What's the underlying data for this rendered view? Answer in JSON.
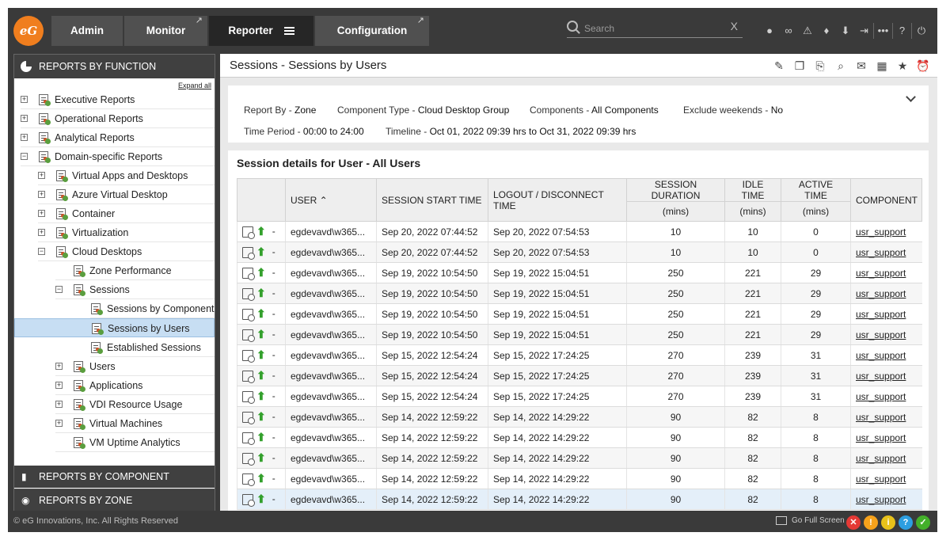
{
  "app": {
    "logo_text": "eG",
    "nav": [
      {
        "label": "Admin"
      },
      {
        "label": "Monitor"
      },
      {
        "label": "Reporter"
      },
      {
        "label": "Configuration"
      }
    ],
    "search_placeholder": "Search"
  },
  "left_panel": {
    "header": "REPORTS BY FUNCTION",
    "expand_all": "Expand all",
    "tree": [
      {
        "label": "Executive Reports",
        "toggle": "+"
      },
      {
        "label": "Operational Reports",
        "toggle": "+"
      },
      {
        "label": "Analytical Reports",
        "toggle": "+"
      },
      {
        "label": "Domain-specific Reports",
        "toggle": "−"
      },
      {
        "label": "Virtual Apps and Desktops",
        "toggle": "+"
      },
      {
        "label": "Azure Virtual Desktop",
        "toggle": "+"
      },
      {
        "label": "Container",
        "toggle": "+"
      },
      {
        "label": "Virtualization",
        "toggle": "+"
      },
      {
        "label": "Cloud Desktops",
        "toggle": "−"
      },
      {
        "label": "Zone Performance",
        "toggle": ""
      },
      {
        "label": "Sessions",
        "toggle": "−"
      },
      {
        "label": "Sessions by Component",
        "toggle": ""
      },
      {
        "label": "Sessions by Users",
        "toggle": ""
      },
      {
        "label": "Established Sessions",
        "toggle": ""
      },
      {
        "label": "Users",
        "toggle": "+"
      },
      {
        "label": "Applications",
        "toggle": "+"
      },
      {
        "label": "VDI Resource Usage",
        "toggle": "+"
      },
      {
        "label": "Virtual Machines",
        "toggle": "+"
      },
      {
        "label": "VM Uptime Analytics",
        "toggle": ""
      }
    ],
    "footer_by_component": "REPORTS BY COMPONENT",
    "footer_by_zone": "REPORTS BY ZONE"
  },
  "main": {
    "title": "Sessions - Sessions by Users",
    "filters": {
      "report_by_label": "Report By - ",
      "report_by_value": "Zone",
      "component_type_label": "Component Type - ",
      "component_type_value": "Cloud Desktop Group",
      "components_label": "Components - ",
      "components_value": "All Components",
      "exclude_weekends_label": "Exclude weekends - ",
      "exclude_weekends_value": "No",
      "time_period_label": "Time Period - ",
      "time_period_value": "00:00 to 24:00",
      "timeline_label": "Timeline - ",
      "timeline_value": "Oct 01, 2022 09:39 hrs to Oct 31, 2022 09:39 hrs"
    },
    "table_title": "Session details for User - All Users",
    "columns": {
      "user": "USER",
      "start": "SESSION START TIME",
      "logout": "LOGOUT / DISCONNECT TIME",
      "duration": "SESSION DURATION",
      "idle": "IDLE TIME",
      "active": "ACTIVE TIME",
      "component": "COMPONENT",
      "unit": "(mins)"
    },
    "rows": [
      {
        "dash": "-",
        "user": "egdevavd\\w365...",
        "start": "Sep 20, 2022 07:44:52",
        "logout": "Sep 20, 2022 07:54:53",
        "duration": "10",
        "idle": "10",
        "active": "0",
        "component": "usr_support"
      },
      {
        "dash": "-",
        "user": "egdevavd\\w365...",
        "start": "Sep 20, 2022 07:44:52",
        "logout": "Sep 20, 2022 07:54:53",
        "duration": "10",
        "idle": "10",
        "active": "0",
        "component": "usr_support"
      },
      {
        "dash": "-",
        "user": "egdevavd\\w365...",
        "start": "Sep 19, 2022 10:54:50",
        "logout": "Sep 19, 2022 15:04:51",
        "duration": "250",
        "idle": "221",
        "active": "29",
        "component": "usr_support"
      },
      {
        "dash": "-",
        "user": "egdevavd\\w365...",
        "start": "Sep 19, 2022 10:54:50",
        "logout": "Sep 19, 2022 15:04:51",
        "duration": "250",
        "idle": "221",
        "active": "29",
        "component": "usr_support"
      },
      {
        "dash": "-",
        "user": "egdevavd\\w365...",
        "start": "Sep 19, 2022 10:54:50",
        "logout": "Sep 19, 2022 15:04:51",
        "duration": "250",
        "idle": "221",
        "active": "29",
        "component": "usr_support"
      },
      {
        "dash": "-",
        "user": "egdevavd\\w365...",
        "start": "Sep 19, 2022 10:54:50",
        "logout": "Sep 19, 2022 15:04:51",
        "duration": "250",
        "idle": "221",
        "active": "29",
        "component": "usr_support"
      },
      {
        "dash": "-",
        "user": "egdevavd\\w365...",
        "start": "Sep 15, 2022 12:54:24",
        "logout": "Sep 15, 2022 17:24:25",
        "duration": "270",
        "idle": "239",
        "active": "31",
        "component": "usr_support"
      },
      {
        "dash": "-",
        "user": "egdevavd\\w365...",
        "start": "Sep 15, 2022 12:54:24",
        "logout": "Sep 15, 2022 17:24:25",
        "duration": "270",
        "idle": "239",
        "active": "31",
        "component": "usr_support"
      },
      {
        "dash": "-",
        "user": "egdevavd\\w365...",
        "start": "Sep 15, 2022 12:54:24",
        "logout": "Sep 15, 2022 17:24:25",
        "duration": "270",
        "idle": "239",
        "active": "31",
        "component": "usr_support"
      },
      {
        "dash": "-",
        "user": "egdevavd\\w365...",
        "start": "Sep 14, 2022 12:59:22",
        "logout": "Sep 14, 2022 14:29:22",
        "duration": "90",
        "idle": "82",
        "active": "8",
        "component": "usr_support"
      },
      {
        "dash": "-",
        "user": "egdevavd\\w365...",
        "start": "Sep 14, 2022 12:59:22",
        "logout": "Sep 14, 2022 14:29:22",
        "duration": "90",
        "idle": "82",
        "active": "8",
        "component": "usr_support"
      },
      {
        "dash": "-",
        "user": "egdevavd\\w365...",
        "start": "Sep 14, 2022 12:59:22",
        "logout": "Sep 14, 2022 14:29:22",
        "duration": "90",
        "idle": "82",
        "active": "8",
        "component": "usr_support"
      },
      {
        "dash": "-",
        "user": "egdevavd\\w365...",
        "start": "Sep 14, 2022 12:59:22",
        "logout": "Sep 14, 2022 14:29:22",
        "duration": "90",
        "idle": "82",
        "active": "8",
        "component": "usr_support"
      },
      {
        "dash": "-",
        "user": "egdevavd\\w365...",
        "start": "Sep 14, 2022 12:59:22",
        "logout": "Sep 14, 2022 14:29:22",
        "duration": "90",
        "idle": "82",
        "active": "8",
        "component": "usr_support"
      }
    ]
  },
  "footer": {
    "copyright": "© eG Innovations, Inc. All Rights Reserved",
    "fullscreen": "Go Full Screen",
    "status_colors": [
      "#e53935",
      "#f7a21b",
      "#e8c21a",
      "#2d9ee0",
      "#43b02a"
    ]
  },
  "colors": {
    "brand": "#f07e1e",
    "selected_tree": "#c7def3",
    "arrow_up": "#33a02c"
  }
}
